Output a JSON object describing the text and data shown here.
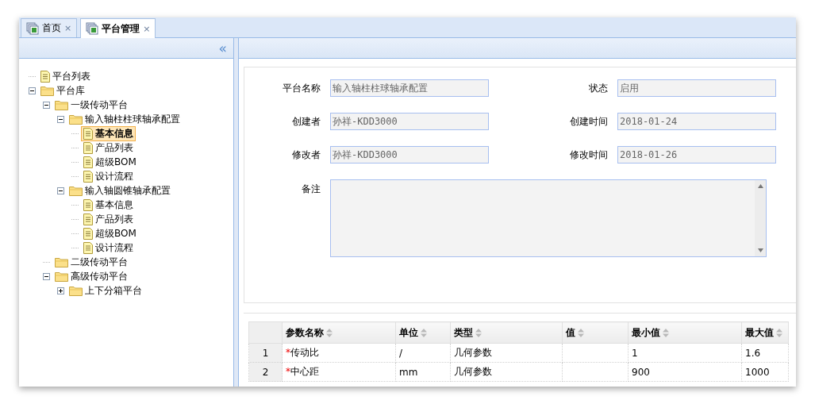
{
  "tabs": [
    {
      "label": "首页",
      "close": "×",
      "selected": false
    },
    {
      "label": "平台管理",
      "close": "×",
      "selected": true
    }
  ],
  "sidebar": {
    "collapse": "«",
    "tree": [
      {
        "label": "平台列表",
        "kind": "doc",
        "selected": false
      },
      {
        "label": "平台库",
        "kind": "folder",
        "expanded": true,
        "selected": false,
        "children": [
          {
            "label": "一级传动平台",
            "kind": "folder",
            "expanded": true,
            "selected": false,
            "children": [
              {
                "label": "输入轴柱柱球轴承配置",
                "kind": "folder",
                "expanded": true,
                "selected": false,
                "children": [
                  {
                    "label": "基本信息",
                    "kind": "doc",
                    "selected": true
                  },
                  {
                    "label": "产品列表",
                    "kind": "doc",
                    "selected": false
                  },
                  {
                    "label": "超级BOM",
                    "kind": "doc",
                    "selected": false
                  },
                  {
                    "label": "设计流程",
                    "kind": "doc",
                    "selected": false
                  }
                ]
              },
              {
                "label": "输入轴圆锥轴承配置",
                "kind": "folder",
                "expanded": true,
                "selected": false,
                "children": [
                  {
                    "label": "基本信息",
                    "kind": "doc",
                    "selected": false
                  },
                  {
                    "label": "产品列表",
                    "kind": "doc",
                    "selected": false
                  },
                  {
                    "label": "超级BOM",
                    "kind": "doc",
                    "selected": false
                  },
                  {
                    "label": "设计流程",
                    "kind": "doc",
                    "selected": false
                  }
                ]
              }
            ]
          },
          {
            "label": "二级传动平台",
            "kind": "folder",
            "selected": false
          },
          {
            "label": "高级传动平台",
            "kind": "folder",
            "expanded": true,
            "selected": false,
            "children": [
              {
                "label": "上下分箱平台",
                "kind": "folder",
                "expanded": false,
                "selected": false
              }
            ]
          }
        ]
      }
    ]
  },
  "form": {
    "fields": [
      {
        "label": "平台名称",
        "value": "输入轴柱柱球轴承配置",
        "kind": "input"
      },
      {
        "label": "状态",
        "value": "启用",
        "kind": "input"
      },
      {
        "label": "创建者",
        "value": "孙祥-KDD3000",
        "kind": "input"
      },
      {
        "label": "创建时间",
        "value": "2018-01-24",
        "kind": "input"
      },
      {
        "label": "修改者",
        "value": "孙祥-KDD3000",
        "kind": "input"
      },
      {
        "label": "修改时间",
        "value": "2018-01-26",
        "kind": "input"
      },
      {
        "label": "备注",
        "kind": "textarea"
      }
    ]
  },
  "table": {
    "columns": [
      "参数名称",
      "单位",
      "类型",
      "值",
      "最小值",
      "最大值"
    ],
    "rows": [
      {
        "index": "1",
        "cells": [
          "传动比",
          "/",
          "几何参数",
          "",
          "1",
          "1.6"
        ],
        "required_mark": "*"
      },
      {
        "index": "2",
        "cells": [
          "中心距",
          "mm",
          "几何参数",
          "",
          "900",
          "1000"
        ],
        "required_mark": "*"
      }
    ]
  }
}
